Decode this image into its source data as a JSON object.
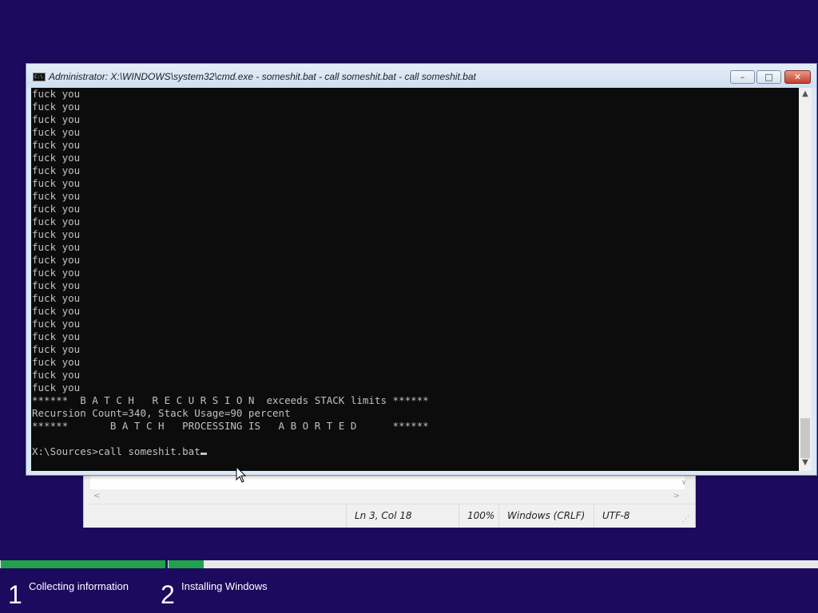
{
  "notepad": {
    "status_position": "Ln 3, Col 18",
    "status_zoom": "100%",
    "status_line_ending": "Windows (CRLF)",
    "status_encoding": "UTF-8"
  },
  "cmd": {
    "title": "Administrator: X:\\WINDOWS\\system32\\cmd.exe - someshit.bat - call  someshit.bat - call  someshit.bat",
    "icon": "cmd-icon",
    "output_lines": [
      "fuck you",
      "fuck you",
      "fuck you",
      "fuck you",
      "fuck you",
      "fuck you",
      "fuck you",
      "fuck you",
      "fuck you",
      "fuck you",
      "fuck you",
      "fuck you",
      "fuck you",
      "fuck you",
      "fuck you",
      "fuck you",
      "fuck you",
      "fuck you",
      "fuck you",
      "fuck you",
      "fuck you",
      "fuck you",
      "fuck you",
      "fuck you",
      "******  B A T C H   R E C U R S I O N  exceeds STACK limits ******",
      "Recursion Count=340, Stack Usage=90 percent",
      "******       B A T C H   PROCESSING IS   A B O R T E D      ******",
      ""
    ],
    "prompt": "X:\\Sources>call someshit.bat"
  },
  "setup": {
    "step1_number": "1",
    "step1_label": "Collecting information",
    "step2_number": "2",
    "step2_label": "Installing Windows",
    "accent_color": "#21a24a",
    "background_color": "#1c0a5e"
  }
}
